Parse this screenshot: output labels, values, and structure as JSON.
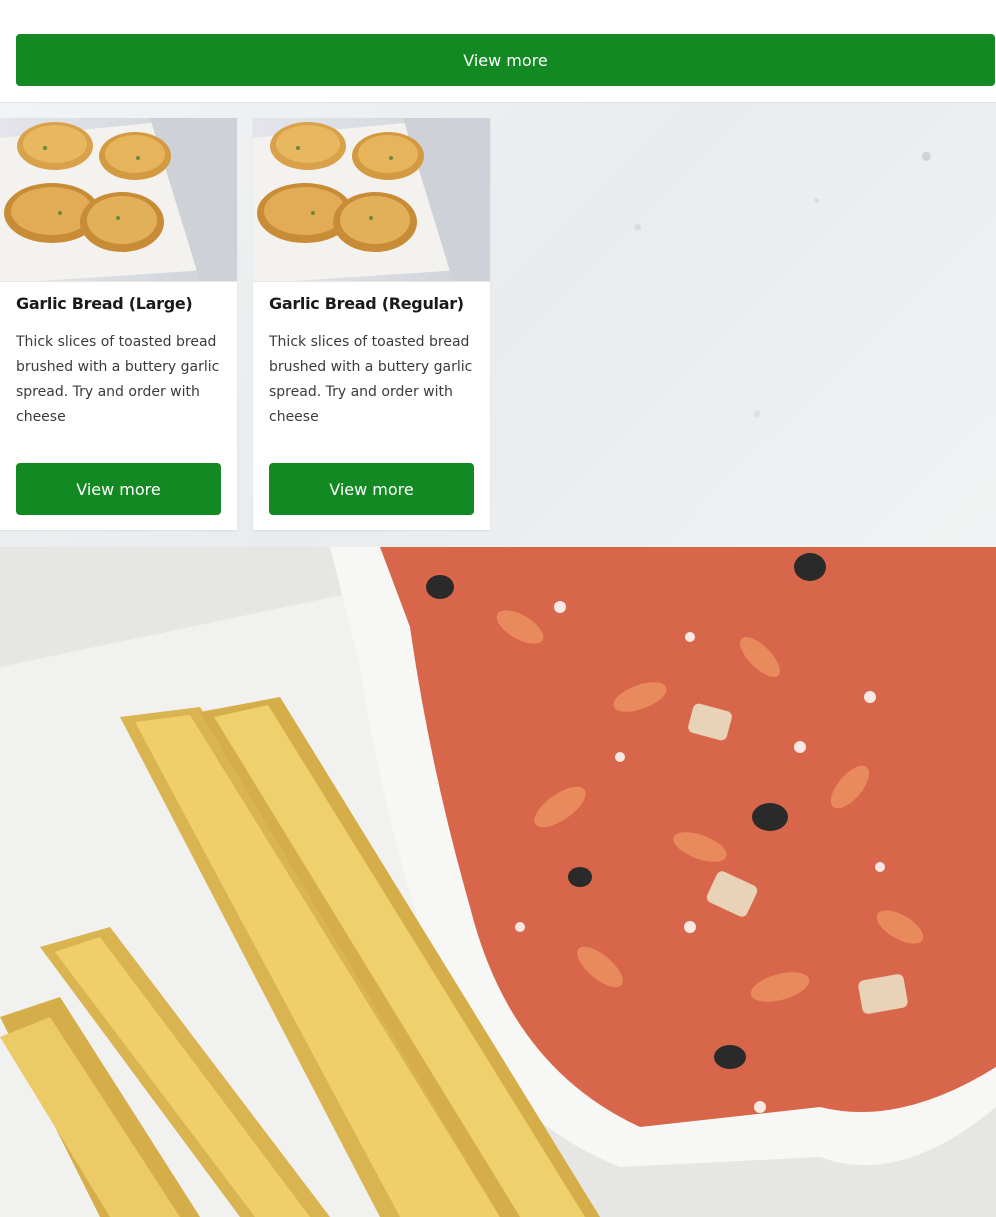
{
  "top_button": {
    "label": "View more"
  },
  "cards": [
    {
      "title": "Garlic Bread (Large)",
      "description": "Thick slices of toasted bread brushed with a buttery garlic spread. Try and order with cheese",
      "button_label": "View more"
    },
    {
      "title": "Garlic Bread (Regular)",
      "description": "Thick slices of toasted bread brushed with a buttery garlic spread. Try and order with cheese",
      "button_label": "View more"
    }
  ],
  "colors": {
    "accent": "#138923",
    "background_texture": "#eef0f1"
  }
}
